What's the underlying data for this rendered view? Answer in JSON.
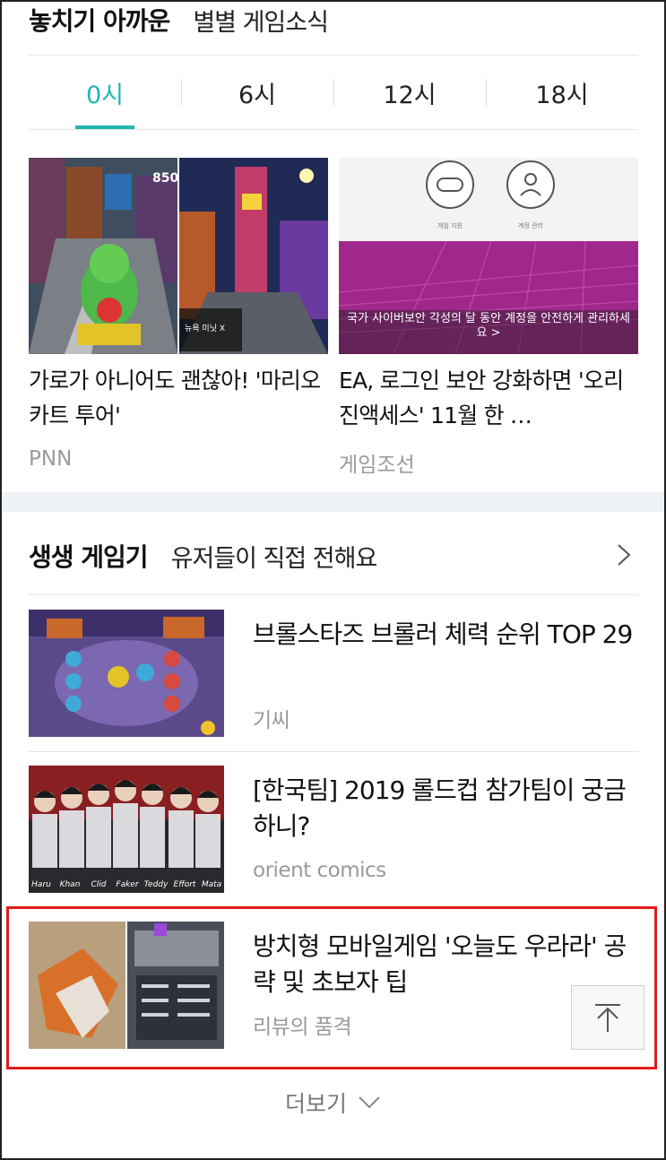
{
  "section1": {
    "title": "놓치기 아까운",
    "subtitle": "별별 게임소식",
    "tabs": [
      "0시",
      "6시",
      "12시",
      "18시"
    ],
    "active_tab": 0,
    "cards": [
      {
        "title": "가로가 아니어도 괜찮아! '마리오 카트 투어'",
        "source": "PNN",
        "thumb_texts": {
          "score": "850",
          "player": "뉴욕 미닛 X"
        }
      },
      {
        "title": "EA, 로그인 보안 강화하면 '오리진액세스' 11월 한 …",
        "source": "게임조선",
        "thumb_texts": {
          "icon1_label": "게임 지원",
          "icon2_label": "계정 관리",
          "banner": "국가 사이버보안 각성의 달 동안 계정을 안전하게 관리하세요 >"
        }
      }
    ]
  },
  "section2": {
    "title": "생생 게임기",
    "subtitle": "유저들이 직접 전해요",
    "items": [
      {
        "title": "브롤스타즈 브롤러 체력 순위 TOP 29",
        "source": "기씨"
      },
      {
        "title": "[한국팀] 2019 롤드컵 참가팀이 궁금하니?",
        "source": "orient comics",
        "thumb_names": [
          "Haru",
          "Khan",
          "Clid",
          "Faker",
          "Teddy",
          "Effort",
          "Mata"
        ]
      },
      {
        "title": "방치형 모바일게임 '오늘도 우라라' 공략 및 초보자 팁",
        "source": "리뷰의 품격"
      }
    ]
  },
  "more_label": "더보기",
  "colors": {
    "accent": "#1fb7b3",
    "highlight": "#e21c1c",
    "banner": "#a0288c"
  }
}
